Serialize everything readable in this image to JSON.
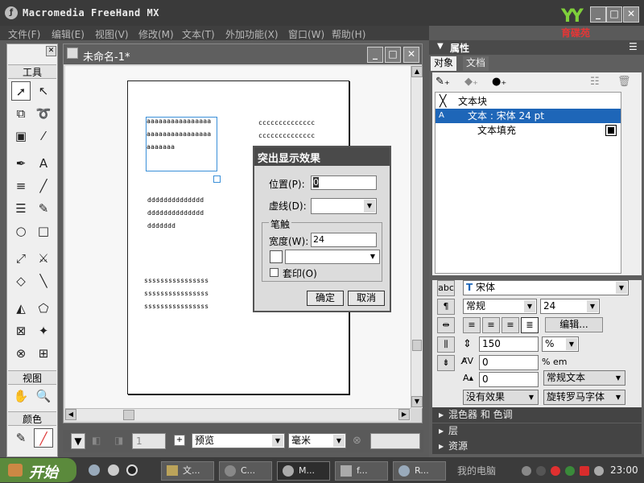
{
  "app": {
    "title": "Macromedia FreeHand MX"
  },
  "brand": {
    "text": "育碟苑"
  },
  "menu": [
    "文件(F)",
    "编辑(E)",
    "视图(V)",
    "修改(M)",
    "文本(T)",
    "外加功能(X)",
    "窗口(W)",
    "帮助(H)"
  ],
  "tools": {
    "title": "工具",
    "view_label": "视图",
    "color_label": "颜色"
  },
  "document": {
    "title": "未命名-1*",
    "text_a": "aaaaaaaaaaaaaaaa\naaaaaaaaaaaaaaaa\naaaaaaa",
    "text_c": "cccccccccccccc\ncccccccccccccc",
    "text_d": "dddddddddddddd\ndddddddddddddd\nddddddd",
    "text_s": "ssssssssssssssss\nssssssssssssssss\nssssssssssssssss"
  },
  "statusbar": {
    "page": "1",
    "view_mode": "预览",
    "unit": "毫米"
  },
  "dialog": {
    "title": "突出显示效果",
    "position_label": "位置(P):",
    "position_value": "0",
    "dash_label": "虚线(D):",
    "stroke_group": "笔触",
    "width_label": "宽度(W):",
    "width_value": "24",
    "overprint_label": "套印(O)",
    "ok": "确定",
    "cancel": "取消"
  },
  "panel": {
    "title": "属性",
    "tabs": [
      "对象",
      "文档"
    ],
    "objects": [
      {
        "label": "文本块"
      },
      {
        "label": "文本 : 宋体 24 pt",
        "marker": "A"
      },
      {
        "label": "文本填充"
      }
    ],
    "text": {
      "font": "宋体",
      "style": "常规",
      "size": "24",
      "edit_button": "编辑...",
      "leading": "150",
      "leading_unit": "%",
      "em": "% em",
      "kerning": "0",
      "baseline": "0",
      "text_mode": "常规文本",
      "effect": "没有效果",
      "rotation": "旋转罗马字体",
      "abc": "abc"
    },
    "groups": [
      "混色器 和 色调",
      "层",
      "资源"
    ]
  },
  "taskbar": {
    "start": "开始",
    "buttons": [
      "文...",
      "C...",
      "M...",
      "f...",
      "R..."
    ],
    "tray_text": "我的电脑",
    "clock": "23:00"
  }
}
